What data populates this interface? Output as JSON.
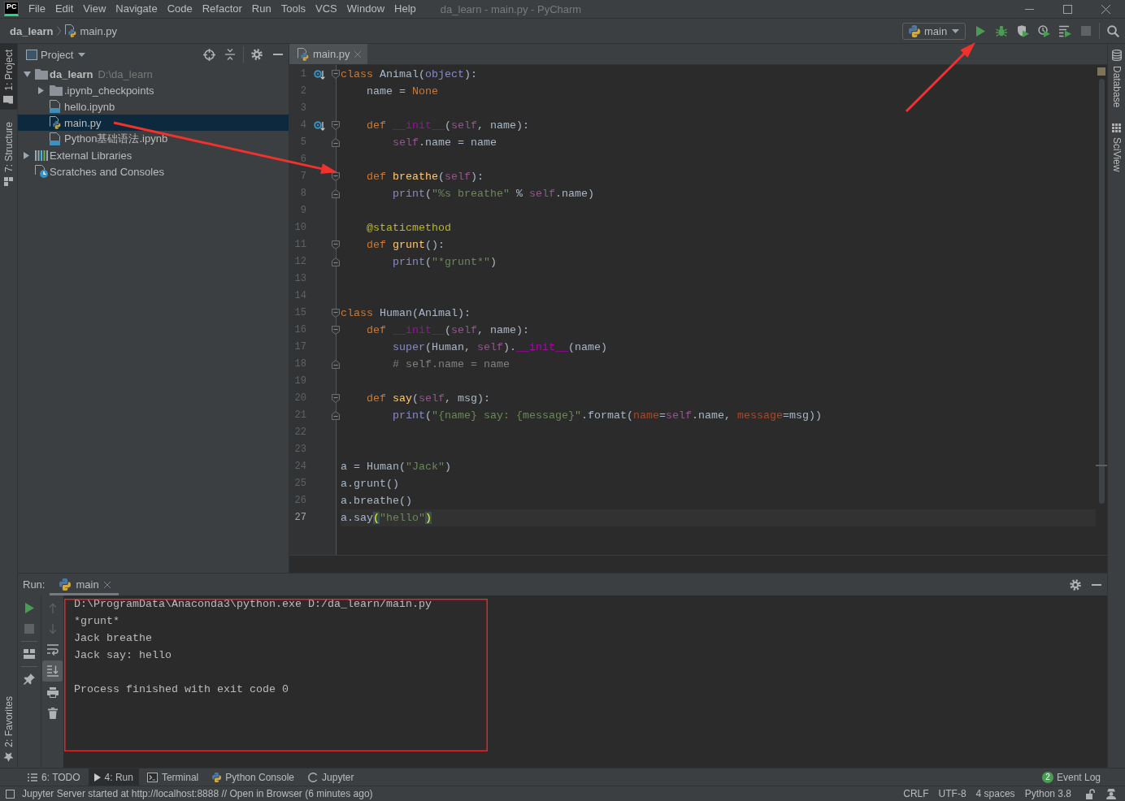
{
  "window": {
    "logo": "PC",
    "menu": [
      "File",
      "Edit",
      "View",
      "Navigate",
      "Code",
      "Refactor",
      "Run",
      "Tools",
      "VCS",
      "Window",
      "Help"
    ],
    "title": "da_learn - main.py - PyCharm",
    "controls": [
      {
        "kind": "minimize"
      },
      {
        "kind": "maximize"
      },
      {
        "kind": "close"
      }
    ]
  },
  "navigation_bar": {
    "breadcrumbs": [
      {
        "label": "da_learn",
        "kind": "folder"
      },
      {
        "label": "main.py",
        "kind": "python"
      }
    ],
    "run_configuration": {
      "label": "main"
    },
    "actions": [
      {
        "kind": "run",
        "disabled": false
      },
      {
        "kind": "debug",
        "disabled": false
      },
      {
        "kind": "coverage",
        "disabled": false
      },
      {
        "kind": "profile",
        "disabled": false
      },
      {
        "kind": "concurrency",
        "disabled": false
      },
      {
        "kind": "stop",
        "disabled": true
      },
      {
        "kind": "search",
        "disabled": false
      }
    ]
  },
  "left_strip": {
    "top": [
      {
        "label": "1: Project",
        "kind": "project",
        "selected": true
      },
      {
        "label": "7: Structure",
        "kind": "structure",
        "selected": false
      }
    ],
    "bottom": [
      {
        "label": "2: Favorites",
        "kind": "favorites",
        "selected": false
      }
    ]
  },
  "project_panel": {
    "title": "Project",
    "actions": [
      {
        "kind": "locate"
      },
      {
        "kind": "collapse_all"
      },
      {
        "kind": "settings"
      },
      {
        "kind": "hide"
      }
    ],
    "tree": [
      {
        "label": "da_learn",
        "location": "D:\\da_learn",
        "kind": "root",
        "expanded": true,
        "selected": false,
        "children": [
          {
            "label": ".ipynb_checkpoints",
            "kind": "folder",
            "expanded": false,
            "selected": false
          },
          {
            "label": "hello.ipynb",
            "kind": "notebook",
            "selected": false
          },
          {
            "label": "main.py",
            "kind": "python",
            "selected": true
          },
          {
            "label": "Python基础语法.ipynb",
            "kind": "notebook",
            "selected": false
          }
        ]
      },
      {
        "label": "External Libraries",
        "kind": "libraries",
        "expanded": false,
        "selected": false
      },
      {
        "label": "Scratches and Consoles",
        "kind": "scratches",
        "selected": false
      }
    ]
  },
  "editor": {
    "tabs": [
      {
        "label": "main.py",
        "selected": true
      }
    ],
    "lines": [
      {
        "number": "1",
        "current": false,
        "overridden": true,
        "fold_start": true,
        "fold_end": false,
        "tokens": [
          {
            "text": "class",
            "kind": "keyword"
          },
          {
            "text": " Animal(",
            "kind": "plain"
          },
          {
            "text": "object",
            "kind": "builtin"
          },
          {
            "text": "):",
            "kind": "plain"
          }
        ]
      },
      {
        "number": "2",
        "current": false,
        "overridden": false,
        "fold_start": false,
        "fold_end": false,
        "tokens": [
          {
            "text": "    name = ",
            "kind": "plain"
          },
          {
            "text": "None",
            "kind": "keyword"
          }
        ]
      },
      {
        "number": "3",
        "current": false,
        "overridden": false,
        "fold_start": false,
        "fold_end": false
      },
      {
        "number": "4",
        "current": false,
        "overridden": true,
        "fold_start": true,
        "fold_end": false,
        "tokens": [
          {
            "text": "    def ",
            "kind": "keyword"
          },
          {
            "text": "__init__",
            "kind": "magic"
          },
          {
            "text": "(",
            "kind": "plain"
          },
          {
            "text": "self",
            "kind": "self"
          },
          {
            "text": ", name):",
            "kind": "plain"
          }
        ]
      },
      {
        "number": "5",
        "current": false,
        "overridden": false,
        "fold_start": false,
        "fold_end": true,
        "tokens": [
          {
            "text": "        self",
            "kind": "self"
          },
          {
            "text": ".name = name",
            "kind": "plain"
          }
        ]
      },
      {
        "number": "6",
        "current": false,
        "overridden": false,
        "fold_start": false,
        "fold_end": false
      },
      {
        "number": "7",
        "current": false,
        "overridden": false,
        "fold_start": true,
        "fold_end": false,
        "tokens": [
          {
            "text": "    def ",
            "kind": "keyword"
          },
          {
            "text": "breathe",
            "kind": "function"
          },
          {
            "text": "(",
            "kind": "plain"
          },
          {
            "text": "self",
            "kind": "self"
          },
          {
            "text": "):",
            "kind": "plain"
          }
        ]
      },
      {
        "number": "8",
        "current": false,
        "overridden": false,
        "fold_start": false,
        "fold_end": true,
        "tokens": [
          {
            "text": "        print",
            "kind": "builtin"
          },
          {
            "text": "(",
            "kind": "plain"
          },
          {
            "text": "\"%s breathe\"",
            "kind": "string"
          },
          {
            "text": " % ",
            "kind": "plain"
          },
          {
            "text": "self",
            "kind": "self"
          },
          {
            "text": ".name)",
            "kind": "plain"
          }
        ]
      },
      {
        "number": "9",
        "current": false,
        "overridden": false,
        "fold_start": false,
        "fold_end": false
      },
      {
        "number": "10",
        "current": false,
        "overridden": false,
        "fold_start": false,
        "fold_end": false,
        "tokens": [
          {
            "text": "    @staticmethod",
            "kind": "decorator"
          }
        ]
      },
      {
        "number": "11",
        "current": false,
        "overridden": false,
        "fold_start": true,
        "fold_end": false,
        "tokens": [
          {
            "text": "    def ",
            "kind": "keyword"
          },
          {
            "text": "grunt",
            "kind": "function"
          },
          {
            "text": "():",
            "kind": "plain"
          }
        ]
      },
      {
        "number": "12",
        "current": false,
        "overridden": false,
        "fold_start": false,
        "fold_end": true,
        "tokens": [
          {
            "text": "        print",
            "kind": "builtin"
          },
          {
            "text": "(",
            "kind": "plain"
          },
          {
            "text": "\"*grunt*\"",
            "kind": "string"
          },
          {
            "text": ")",
            "kind": "plain"
          }
        ]
      },
      {
        "number": "13",
        "current": false,
        "overridden": false,
        "fold_start": false,
        "fold_end": false
      },
      {
        "number": "14",
        "current": false,
        "overridden": false,
        "fold_start": false,
        "fold_end": false
      },
      {
        "number": "15",
        "current": false,
        "overridden": false,
        "fold_start": true,
        "fold_end": false,
        "tokens": [
          {
            "text": "class",
            "kind": "keyword"
          },
          {
            "text": " Human(Animal):",
            "kind": "plain"
          }
        ]
      },
      {
        "number": "16",
        "current": false,
        "overridden": false,
        "fold_start": true,
        "fold_end": false,
        "tokens": [
          {
            "text": "    def ",
            "kind": "keyword"
          },
          {
            "text": "__init__",
            "kind": "magic"
          },
          {
            "text": "(",
            "kind": "plain"
          },
          {
            "text": "self",
            "kind": "self"
          },
          {
            "text": ", name):",
            "kind": "plain"
          }
        ]
      },
      {
        "number": "17",
        "current": false,
        "overridden": false,
        "fold_start": false,
        "fold_end": false,
        "tokens": [
          {
            "text": "        super",
            "kind": "builtin"
          },
          {
            "text": "(Human, ",
            "kind": "plain"
          },
          {
            "text": "self",
            "kind": "self"
          },
          {
            "text": ").",
            "kind": "plain"
          },
          {
            "text": "__init__",
            "kind": "magic"
          },
          {
            "text": "(name)",
            "kind": "plain"
          }
        ]
      },
      {
        "number": "18",
        "current": false,
        "overridden": false,
        "fold_start": false,
        "fold_end": true,
        "tokens": [
          {
            "text": "        # self.name = name",
            "kind": "comment"
          }
        ]
      },
      {
        "number": "19",
        "current": false,
        "overridden": false,
        "fold_start": false,
        "fold_end": false
      },
      {
        "number": "20",
        "current": false,
        "overridden": false,
        "fold_start": true,
        "fold_end": false,
        "tokens": [
          {
            "text": "    def ",
            "kind": "keyword"
          },
          {
            "text": "say",
            "kind": "function"
          },
          {
            "text": "(",
            "kind": "plain"
          },
          {
            "text": "self",
            "kind": "self"
          },
          {
            "text": ", msg):",
            "kind": "plain"
          }
        ]
      },
      {
        "number": "21",
        "current": false,
        "overridden": false,
        "fold_start": false,
        "fold_end": true,
        "tokens": [
          {
            "text": "        print",
            "kind": "builtin"
          },
          {
            "text": "(",
            "kind": "plain"
          },
          {
            "text": "\"{name} say: {message}\"",
            "kind": "string"
          },
          {
            "text": ".format(",
            "kind": "plain"
          },
          {
            "text": "name",
            "kind": "named_arg"
          },
          {
            "text": "=",
            "kind": "plain"
          },
          {
            "text": "self",
            "kind": "self"
          },
          {
            "text": ".name, ",
            "kind": "plain"
          },
          {
            "text": "message",
            "kind": "named_arg"
          },
          {
            "text": "=msg))",
            "kind": "plain"
          }
        ]
      },
      {
        "number": "22",
        "current": false,
        "overridden": false,
        "fold_start": false,
        "fold_end": false
      },
      {
        "number": "23",
        "current": false,
        "overridden": false,
        "fold_start": false,
        "fold_end": false
      },
      {
        "number": "24",
        "current": false,
        "overridden": false,
        "fold_start": false,
        "fold_end": false,
        "tokens": [
          {
            "text": "a = Human(",
            "kind": "plain"
          },
          {
            "text": "\"Jack\"",
            "kind": "string"
          },
          {
            "text": ")",
            "kind": "plain"
          }
        ]
      },
      {
        "number": "25",
        "current": false,
        "overridden": false,
        "fold_start": false,
        "fold_end": false,
        "tokens": [
          {
            "text": "a.grunt()",
            "kind": "plain"
          }
        ]
      },
      {
        "number": "26",
        "current": false,
        "overridden": false,
        "fold_start": false,
        "fold_end": false,
        "tokens": [
          {
            "text": "a.breathe()",
            "kind": "plain"
          }
        ]
      },
      {
        "number": "27",
        "current": true,
        "overridden": false,
        "fold_start": false,
        "fold_end": false,
        "tokens": [
          {
            "text": "a.say",
            "kind": "plain"
          },
          {
            "text": "(",
            "kind": "brace"
          },
          {
            "text": "\"hello\"",
            "kind": "string"
          },
          {
            "text": ")",
            "kind": "brace"
          }
        ]
      }
    ]
  },
  "right_strip": [
    {
      "label": "Database",
      "kind": "database",
      "selected": false
    },
    {
      "label": "SciView",
      "kind": "sciview",
      "selected": false
    }
  ],
  "run_panel": {
    "label": "Run:",
    "tabs": [
      {
        "label": "main",
        "selected": true
      }
    ],
    "header_actions": [
      {
        "kind": "settings"
      },
      {
        "kind": "hide"
      }
    ],
    "side_toolbar": [
      {
        "kind": "rerun",
        "disabled": false
      },
      {
        "kind": "stop",
        "disabled": true
      },
      {
        "kind": "layout",
        "disabled": false
      },
      {
        "kind": "pin",
        "disabled": false
      }
    ],
    "console_toolbar": [
      {
        "kind": "up",
        "disabled": true,
        "on": false
      },
      {
        "kind": "down",
        "disabled": true,
        "on": false
      },
      {
        "kind": "soft_wrap",
        "disabled": false,
        "on": false
      },
      {
        "kind": "scroll_to_end",
        "disabled": false,
        "on": true
      },
      {
        "kind": "print",
        "disabled": false,
        "on": false
      },
      {
        "kind": "clear",
        "disabled": false,
        "on": false
      }
    ],
    "console": [
      {
        "text": "D:\\ProgramData\\Anaconda3\\python.exe D:/da_learn/main.py",
        "kind": "command"
      },
      {
        "text": "*grunt*",
        "kind": "output"
      },
      {
        "text": "Jack breathe",
        "kind": "output"
      },
      {
        "text": "Jack say: hello",
        "kind": "output"
      },
      {
        "text": "Process finished with exit code 0",
        "kind": "exit"
      }
    ]
  },
  "tool_window_bar": {
    "items": [
      {
        "label": "6: TODO",
        "kind": "todo",
        "selected": false
      },
      {
        "label": "4: Run",
        "kind": "run",
        "selected": true
      },
      {
        "label": "Terminal",
        "kind": "terminal",
        "selected": false
      },
      {
        "label": "Python Console",
        "kind": "python_console",
        "selected": false
      },
      {
        "label": "Jupyter",
        "kind": "jupyter",
        "selected": false
      }
    ],
    "event_log": {
      "label": "Event Log",
      "count": "2"
    }
  },
  "status_bar": {
    "message": "Jupyter Server started at http://localhost:8888 // Open in Browser (6 minutes ago)",
    "items": [
      "CRLF",
      "UTF-8",
      "4 spaces",
      "Python 3.8"
    ],
    "icons": [
      {
        "kind": "lock"
      },
      {
        "kind": "inspector"
      }
    ]
  },
  "annotations": [
    {
      "kind": "arrow"
    },
    {
      "kind": "arrow"
    },
    {
      "kind": "frame"
    }
  ]
}
